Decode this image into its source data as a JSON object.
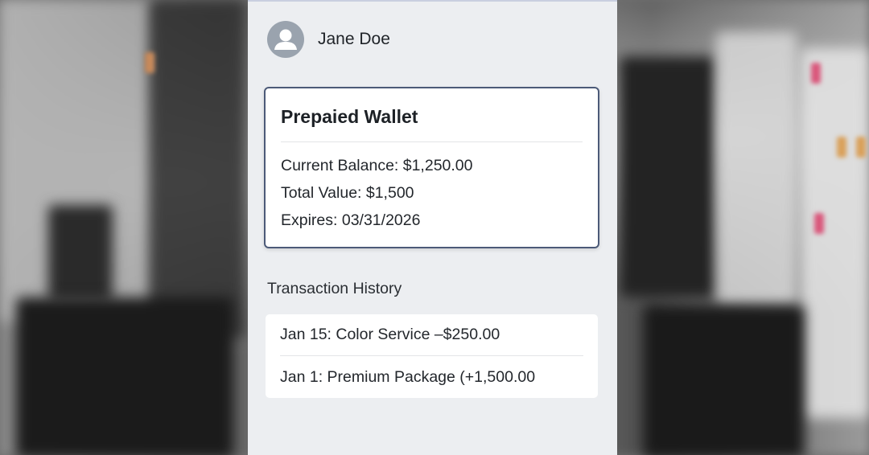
{
  "profile": {
    "name": "Jane Doe",
    "avatar_icon": "user-icon"
  },
  "wallet": {
    "title": "Prepaied Wallet",
    "current_balance": "Current Balance: $1,250.00",
    "total_value": "Total Value: $1,500",
    "expires": "Expires: 03/31/2026",
    "border_color": "#4c5a78"
  },
  "history": {
    "heading": "Transaction History",
    "transactions": [
      {
        "text": "Jan 15: Color Service –$250.00"
      },
      {
        "text": "Jan 1: Premium Package (+1,500.00"
      }
    ]
  },
  "colors": {
    "panel_bg": "#eceef1",
    "card_bg": "#ffffff",
    "avatar_bg": "#9aa3ae"
  }
}
